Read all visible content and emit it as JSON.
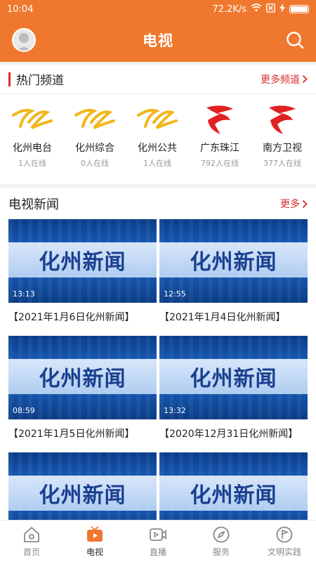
{
  "status": {
    "time": "10:04",
    "speed": "72.2K/s",
    "battery_level": 1.0
  },
  "header": {
    "title": "电视"
  },
  "channels": {
    "section_title": "热门频道",
    "more_label": "更多频道",
    "items": [
      {
        "name": "化州电台",
        "online": "1人在线",
        "logo": "huazhou-logo"
      },
      {
        "name": "化州综合",
        "online": "0人在线",
        "logo": "huazhou-logo"
      },
      {
        "name": "化州公共",
        "online": "1人在线",
        "logo": "huazhou-logo"
      },
      {
        "name": "广东珠江",
        "online": "792人在线",
        "logo": "guangdong-logo"
      },
      {
        "name": "南方卫视",
        "online": "377人在线",
        "logo": "guangdong-logo"
      }
    ]
  },
  "news": {
    "section_title": "电视新闻",
    "more_label": "更多",
    "thumbnail_text": "化州新闻",
    "items": [
      {
        "title": "【2021年1月6日化州新闻】",
        "duration": "13:13"
      },
      {
        "title": "【2021年1月4日化州新闻】",
        "duration": "12:55"
      },
      {
        "title": "【2021年1月5日化州新闻】",
        "duration": "08:59"
      },
      {
        "title": "【2020年12月31日化州新闻】",
        "duration": "13:32"
      },
      {
        "title": "",
        "duration": ""
      },
      {
        "title": "",
        "duration": ""
      }
    ]
  },
  "tabs": [
    {
      "label": "首页",
      "icon": "home-icon",
      "active": false
    },
    {
      "label": "电视",
      "icon": "tv-icon",
      "active": true
    },
    {
      "label": "直播",
      "icon": "live-camera-icon",
      "active": false
    },
    {
      "label": "服务",
      "icon": "compass-icon",
      "active": false
    },
    {
      "label": "文明实践",
      "icon": "flag-circle-icon",
      "active": false
    }
  ],
  "colors": {
    "brand": "#f0782e",
    "accent_red": "#d92b2b",
    "logo_gold": "#f2b619"
  }
}
